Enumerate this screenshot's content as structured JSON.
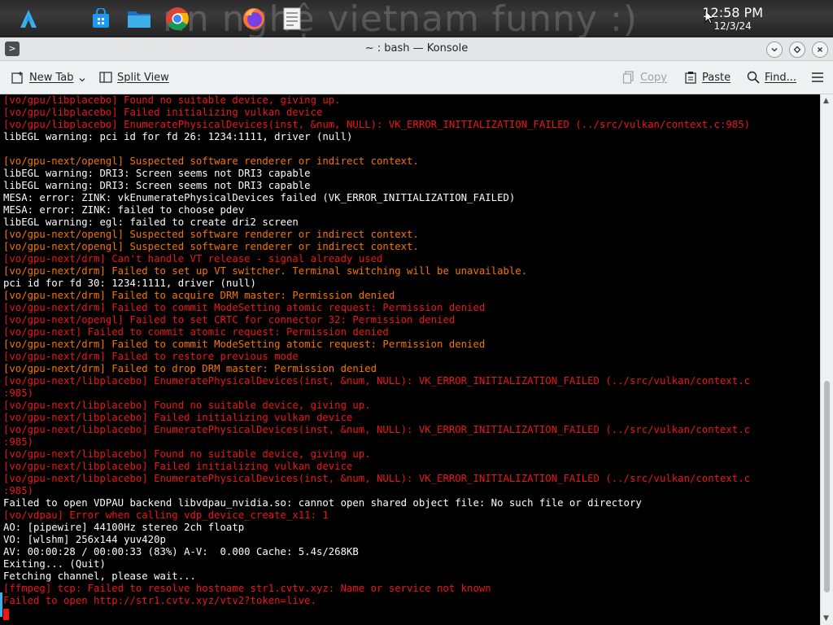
{
  "panel": {
    "background_text": "nn nghệ vietnam funny :)",
    "icons": [
      "launcher-icon",
      "store-icon",
      "files-icon",
      "chrome-icon",
      "firefox-icon",
      "text-editor-icon"
    ],
    "clock": {
      "time": "12:58 PM",
      "date": "12/3/24"
    }
  },
  "window": {
    "title": "~ : bash — Konsole",
    "menu_glyph": ">",
    "toolbar": {
      "new_tab": "New Tab",
      "split_view": "Split View",
      "copy": "Copy",
      "paste": "Paste",
      "find": "Find..."
    }
  },
  "colors": {
    "white": "#fcfcfc",
    "orange": "#f67400",
    "red": "#ed1515",
    "accent": "#3daee9"
  },
  "terminal": {
    "lines": [
      {
        "c": "r",
        "t": "[vo/gpu/libplacebo] Found no suitable device, giving up."
      },
      {
        "c": "r",
        "t": "[vo/gpu/libplacebo] Failed initializing vulkan device"
      },
      {
        "c": "r",
        "t": "[vo/gpu/libplacebo] EnumeratePhysicalDevices(inst, &num, NULL): VK_ERROR_INITIALIZATION_FAILED (../src/vulkan/context.c:985)"
      },
      {
        "c": "w",
        "t": "libEGL warning: pci id for fd 26: 1234:1111, driver (null)"
      },
      {
        "c": "w",
        "t": ""
      },
      {
        "c": "o",
        "t": "[vo/gpu-next/opengl] Suspected software renderer or indirect context."
      },
      {
        "c": "w",
        "t": "libEGL warning: DRI3: Screen seems not DRI3 capable"
      },
      {
        "c": "w",
        "t": "libEGL warning: DRI3: Screen seems not DRI3 capable"
      },
      {
        "c": "w",
        "t": "MESA: error: ZINK: vkEnumeratePhysicalDevices failed (VK_ERROR_INITIALIZATION_FAILED)"
      },
      {
        "c": "w",
        "t": "MESA: error: ZINK: failed to choose pdev"
      },
      {
        "c": "w",
        "t": "libEGL warning: egl: failed to create dri2 screen"
      },
      {
        "c": "o",
        "t": "[vo/gpu-next/opengl] Suspected software renderer or indirect context."
      },
      {
        "c": "o",
        "t": "[vo/gpu-next/opengl] Suspected software renderer or indirect context."
      },
      {
        "c": "r",
        "t": "[vo/gpu-next/drm] Can't handle VT release - signal already used"
      },
      {
        "c": "o",
        "t": "[vo/gpu-next/drm] Failed to set up VT switcher. Terminal switching will be unavailable."
      },
      {
        "c": "w",
        "t": "pci id for fd 30: 1234:1111, driver (null)"
      },
      {
        "c": "o",
        "t": "[vo/gpu-next/drm] Failed to acquire DRM master: Permission denied"
      },
      {
        "c": "r",
        "t": "[vo/gpu-next/drm] Failed to commit ModeSetting atomic request: Permission denied"
      },
      {
        "c": "r",
        "t": "[vo/gpu-next/opengl] Failed to set CRTC for connector 32: Permission denied"
      },
      {
        "c": "r",
        "t": "[vo/gpu-next] Failed to commit atomic request: Permission denied"
      },
      {
        "c": "o",
        "t": "[vo/gpu-next/drm] Failed to commit ModeSetting atomic request: Permission denied"
      },
      {
        "c": "r",
        "t": "[vo/gpu-next/drm] Failed to restore previous mode"
      },
      {
        "c": "o",
        "t": "[vo/gpu-next/drm] Failed to drop DRM master: Permission denied"
      },
      {
        "c": "r",
        "t": "[vo/gpu-next/libplacebo] EnumeratePhysicalDevices(inst, &num, NULL): VK_ERROR_INITIALIZATION_FAILED (../src/vulkan/context.c"
      },
      {
        "c": "r",
        "t": ":985)"
      },
      {
        "c": "r",
        "t": "[vo/gpu-next/libplacebo] Found no suitable device, giving up."
      },
      {
        "c": "r",
        "t": "[vo/gpu-next/libplacebo] Failed initializing vulkan device"
      },
      {
        "c": "r",
        "t": "[vo/gpu-next/libplacebo] EnumeratePhysicalDevices(inst, &num, NULL): VK_ERROR_INITIALIZATION_FAILED (../src/vulkan/context.c"
      },
      {
        "c": "r",
        "t": ":985)"
      },
      {
        "c": "r",
        "t": "[vo/gpu-next/libplacebo] Found no suitable device, giving up."
      },
      {
        "c": "r",
        "t": "[vo/gpu-next/libplacebo] Failed initializing vulkan device"
      },
      {
        "c": "r",
        "t": "[vo/gpu-next/libplacebo] EnumeratePhysicalDevices(inst, &num, NULL): VK_ERROR_INITIALIZATION_FAILED (../src/vulkan/context.c"
      },
      {
        "c": "r",
        "t": ":985)"
      },
      {
        "c": "w",
        "t": "Failed to open VDPAU backend libvdpau_nvidia.so: cannot open shared object file: No such file or directory"
      },
      {
        "c": "r",
        "t": "[vo/vdpau] Error when calling vdp_device_create_x11: 1"
      },
      {
        "c": "w",
        "t": "AO: [pipewire] 44100Hz stereo 2ch floatp"
      },
      {
        "c": "w",
        "t": "VO: [wlshm] 256x144 yuv420p"
      },
      {
        "c": "w",
        "t": "AV: 00:00:28 / 00:00:33 (83%) A-V:  0.000 Cache: 5.4s/268KB"
      },
      {
        "c": "w",
        "t": "Exiting... (Quit)"
      },
      {
        "c": "w",
        "t": "Fetching channel, please wait..."
      },
      {
        "c": "r",
        "t": "[ffmpeg] tcp: Failed to resolve hostname str1.cvtv.xyz: Name or service not known"
      },
      {
        "c": "r",
        "t": "Failed to open http://str1.cvtv.xyz/vtv2?token=live."
      }
    ]
  }
}
